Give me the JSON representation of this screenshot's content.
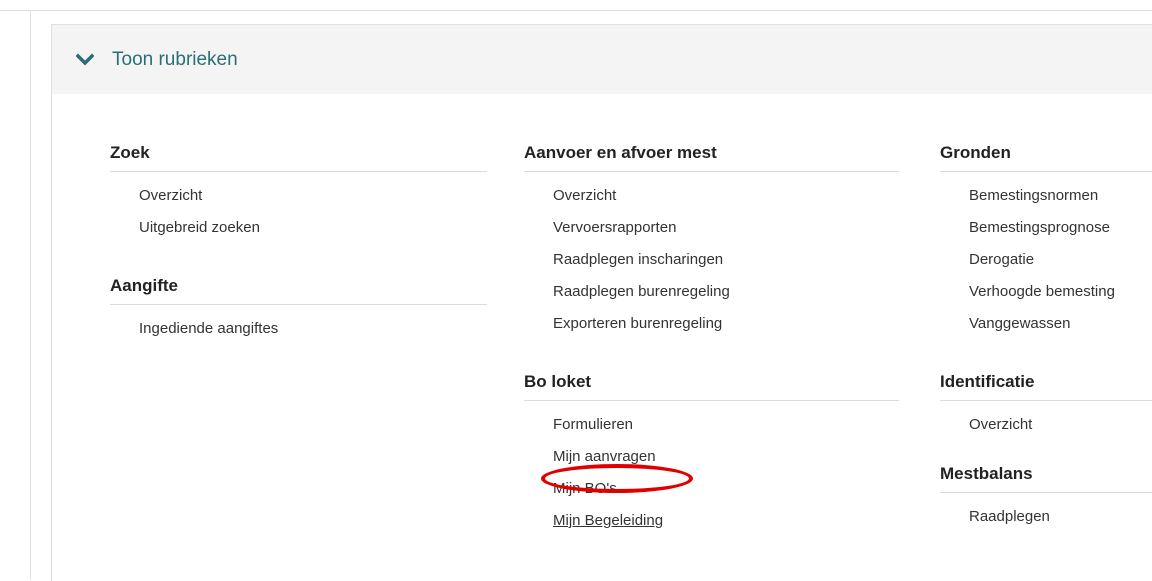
{
  "header": {
    "title": "Toon rubrieken"
  },
  "columns": [
    {
      "sections": [
        {
          "title": "Zoek",
          "items": [
            "Overzicht",
            "Uitgebreid zoeken"
          ]
        },
        {
          "title": "Aangifte",
          "items": [
            "Ingediende aangiftes"
          ]
        }
      ]
    },
    {
      "sections": [
        {
          "title": "Aanvoer en afvoer mest",
          "items": [
            "Overzicht",
            "Vervoersrapporten",
            "Raadplegen inscharingen",
            "Raadplegen burenregeling",
            "Exporteren burenregeling"
          ]
        },
        {
          "title": "Bo loket",
          "items": [
            "Formulieren",
            "Mijn aanvragen",
            "Mijn BO's",
            "Mijn Begeleiding"
          ]
        }
      ]
    },
    {
      "sections": [
        {
          "title": "Gronden",
          "items": [
            "Bemestingsnormen",
            "Bemestingsprognose",
            "Derogatie",
            "Verhoogde bemesting",
            "Vanggewassen"
          ]
        },
        {
          "title": "Identificatie",
          "items": [
            "Overzicht"
          ]
        },
        {
          "title": "Mestbalans",
          "items": [
            "Raadplegen"
          ]
        }
      ]
    }
  ],
  "colors": {
    "accent": "#2a6f76",
    "highlight": "#e00000",
    "header_bg": "#f4f4f4"
  },
  "icons": {
    "toggle": "chevron-down-icon"
  }
}
